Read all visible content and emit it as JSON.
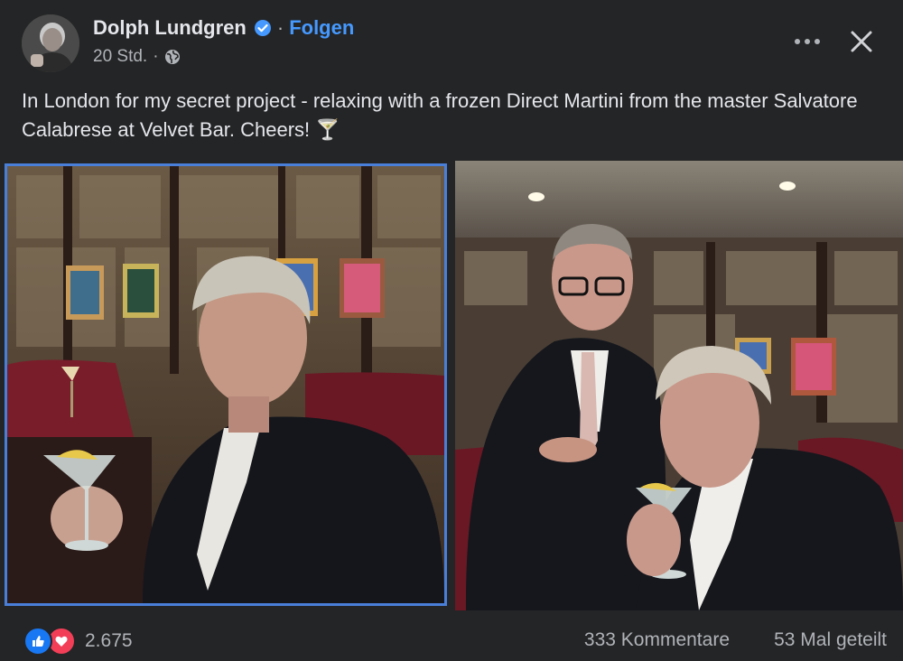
{
  "post": {
    "author": "Dolph Lundgren",
    "separator": "·",
    "follow_label": "Folgen",
    "timestamp": "20 Std.",
    "meta_separator": "·",
    "privacy_icon": "globe-icon",
    "verified_icon": "verified-badge-icon",
    "caption": "In London for my secret project - relaxing with a frozen Direct Martini from the master Salvatore Calabrese at Velvet Bar. Cheers! 🍸",
    "more_icon": "more-options-icon",
    "close_icon": "close-icon"
  },
  "photos": [
    {
      "subject": "photo-man-holding-martini"
    },
    {
      "subject": "photo-bartender-and-man-tasting-martini"
    }
  ],
  "footer": {
    "reaction_count": "2.675",
    "reaction_icons": [
      "like-icon",
      "love-icon"
    ],
    "comments_label": "333 Kommentare",
    "shares_label": "53 Mal geteilt"
  },
  "colors": {
    "background": "#242526",
    "text": "#e4e6eb",
    "secondary_text": "#b0b3b8",
    "accent": "#4599ff",
    "like": "#1877f2",
    "love": "#f33e58",
    "selected_border": "#4a7fd9"
  }
}
